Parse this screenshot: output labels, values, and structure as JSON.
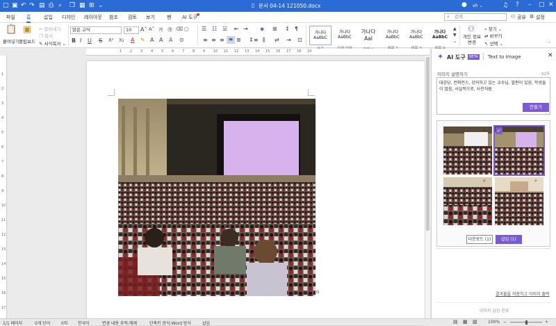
{
  "titlebar": {
    "doc_title": "문서 04-14 121050.docx"
  },
  "menu": {
    "items": [
      "파일",
      "홈",
      "삽입",
      "디자인",
      "레이아웃",
      "참조",
      "검토",
      "보기",
      "펜",
      "AI 도구"
    ],
    "search_placeholder": "검색",
    "share": "공유",
    "settings": "설정"
  },
  "ribbon": {
    "paste": "붙여넣기",
    "clipboard": "클립보드",
    "cut": "잘라내기",
    "copy": "복사",
    "format_painter": "서식복사",
    "font_name": "맑은 고딕",
    "font_size": "10",
    "styles": [
      {
        "sample": "가나다AaBbC",
        "name": "표준"
      },
      {
        "sample": "가나다AaBbC",
        "name": "간격 없음"
      },
      {
        "sample": "가나다Aal",
        "name": "제목 1"
      },
      {
        "sample": "가나다AaBbC",
        "name": "제목 2"
      },
      {
        "sample": "가나다AaBbC",
        "name": "제목 3"
      },
      {
        "sample": "가나다AaBbC",
        "name": "제목 4"
      }
    ],
    "personal_info": "개인 정보 변경",
    "find": "찾기",
    "replace": "바꾸기",
    "select": "선택"
  },
  "ruler": {
    "h_numbers": [
      "1",
      "2",
      "3",
      "4",
      "5",
      "6",
      "7",
      "8",
      "9",
      "10",
      "11",
      "12",
      "13",
      "14",
      "15",
      "16",
      "17",
      "18",
      "19"
    ],
    "v_numbers": [
      "1",
      "2",
      "3",
      "4",
      "5",
      "6",
      "7",
      "8",
      "9",
      "10",
      "11",
      "12",
      "13",
      "14",
      "15",
      "16",
      "17"
    ]
  },
  "ai_panel": {
    "title": "AI 도구",
    "beta": "BETA",
    "tab": "Text to Image",
    "prompt_label": "이미지 설명하기",
    "char_count": "52자",
    "prompt_text": "대강당, 컨퍼런스, 강의하고 있는 교수님, 필판이 있음, 학생들이 많음, 사실적으로, 사진처럼",
    "generate_button": "만들기",
    "download_button": "다운로드 (1)",
    "insert_button": "삽입 (1)",
    "save_link": "결과물을 저장하고 이미지 출력",
    "footer_text": "이미지 삽입 완료"
  },
  "status": {
    "page": "1/1 페이지",
    "words": "0개 단어",
    "chars": "0자",
    "language": "한국어",
    "track": "변경 내용 추적:해제",
    "mode": "단축키 방식:Word 방식",
    "insert": "삽입",
    "zoom": "100%"
  },
  "colors": {
    "accent": "#2b6bd6",
    "purple": "#7a5bd1",
    "font_red": "#d9262b",
    "highlight": "#f2d21b"
  }
}
